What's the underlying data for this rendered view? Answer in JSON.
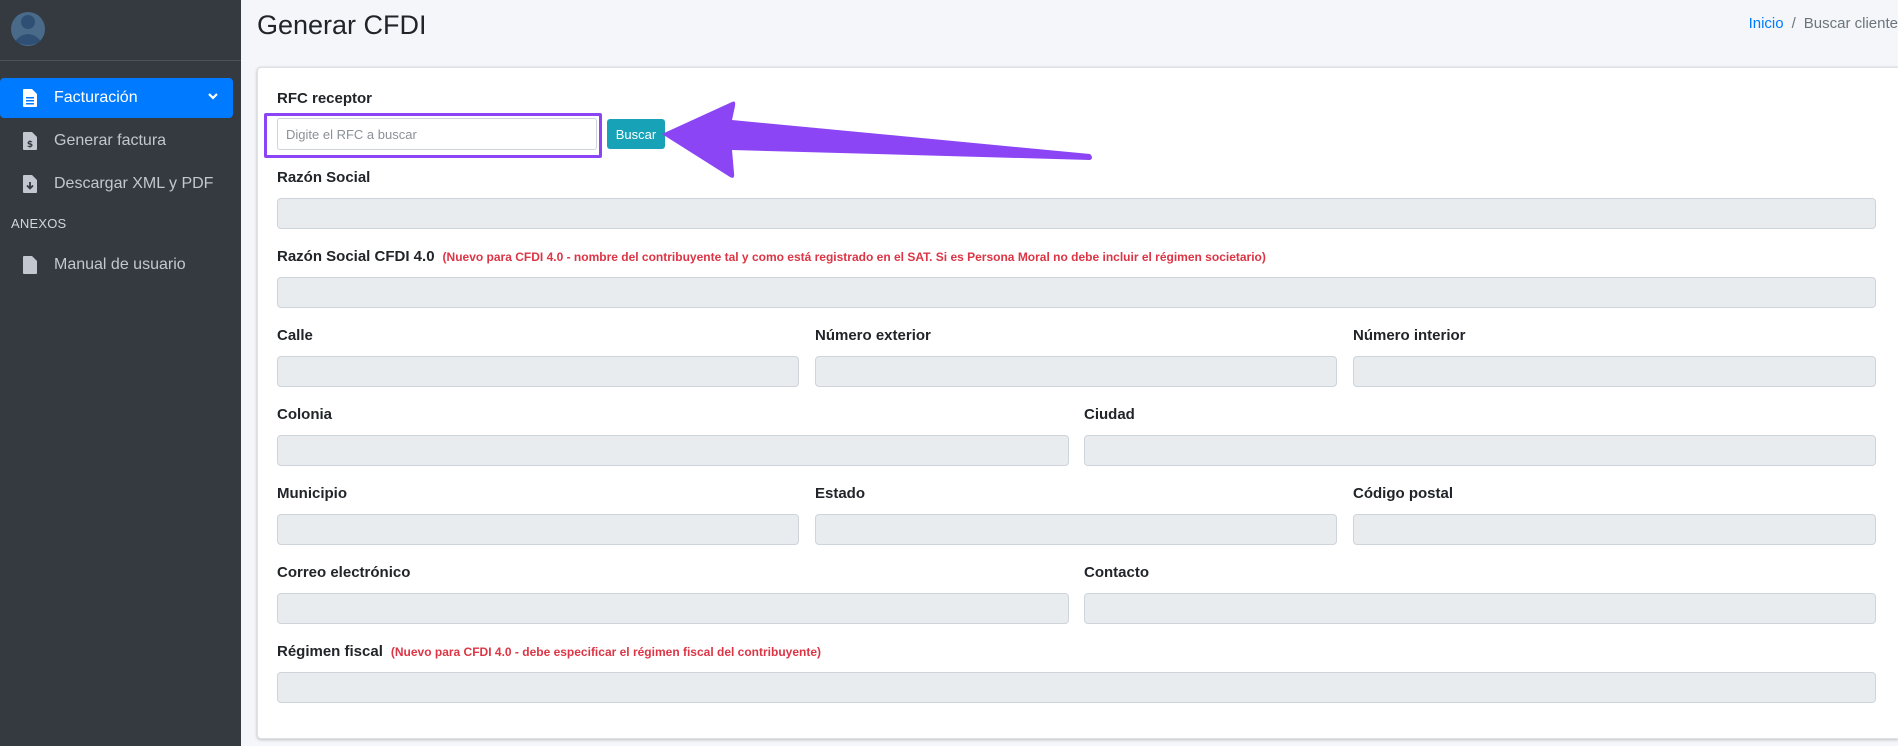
{
  "sidebar": {
    "items": [
      {
        "label": "Facturación",
        "icon": "file-invoice-icon",
        "active": true
      },
      {
        "label": "Generar factura",
        "icon": "file-dollar-icon"
      },
      {
        "label": "Descargar XML y PDF",
        "icon": "file-download-icon"
      }
    ],
    "section_header": "ANEXOS",
    "annex_items": [
      {
        "label": "Manual de usuario",
        "icon": "file-icon"
      }
    ]
  },
  "header": {
    "title": "Generar CFDI",
    "breadcrumb": {
      "home": "Inicio",
      "separator": "/",
      "current": "Buscar cliente"
    }
  },
  "form": {
    "rfc_label": "RFC receptor",
    "rfc_placeholder": "Digite el RFC a buscar",
    "rfc_value": "",
    "search_button": "Buscar",
    "razon_social": "Razón Social",
    "razon_social_40": "Razón Social CFDI 4.0",
    "razon_social_40_note": "(Nuevo para CFDI 4.0 - nombre del contribuyente tal y como está registrado en el SAT. Si es Persona Moral no debe incluir el régimen societario)",
    "calle": "Calle",
    "numero_exterior": "Número exterior",
    "numero_interior": "Número interior",
    "colonia": "Colonia",
    "ciudad": "Ciudad",
    "municipio": "Municipio",
    "estado": "Estado",
    "codigo_postal": "Código postal",
    "correo": "Correo electrónico",
    "contacto": "Contacto",
    "regimen_fiscal": "Régimen fiscal",
    "regimen_fiscal_note": "(Nuevo para CFDI 4.0 - debe especificar el régimen fiscal del contribuyente)"
  },
  "colors": {
    "sidebar_bg": "#343a40",
    "active_item": "#007bff",
    "button": "#17a2b8",
    "annotation": "#8b45f5",
    "note_text": "#dc3545"
  }
}
